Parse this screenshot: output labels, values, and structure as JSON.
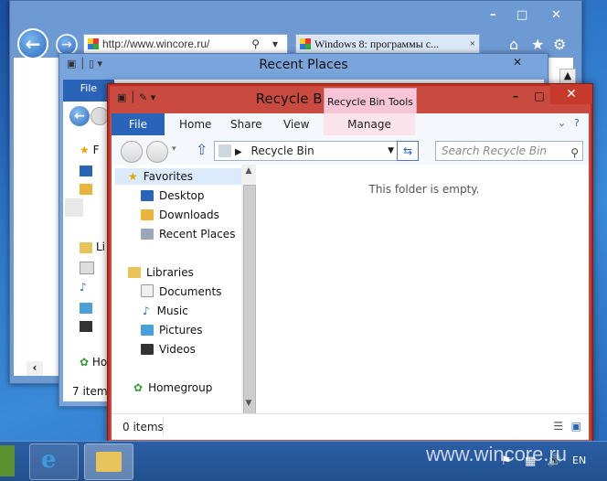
{
  "ie": {
    "url": "http://www.wincore.ru/",
    "tab_title": "Windows 8: программы с...",
    "tab_close": "×",
    "minimize": "–",
    "maximize": "□",
    "close": "✕",
    "back_glyph": "←",
    "forward_glyph": "→"
  },
  "recent_places": {
    "title": "Recent Places",
    "file_menu": "File",
    "status": "7 items",
    "side_items": [
      "F",
      "",
      "",
      "",
      "Li",
      "",
      "",
      "",
      "",
      "Ho"
    ],
    "close": "✕"
  },
  "recycle_bin": {
    "title": "Recycle Bin",
    "tools_tab": "Recycle Bin Tools",
    "menu": {
      "file": "File",
      "home": "Home",
      "share": "Share",
      "view": "View",
      "manage": "Manage"
    },
    "address": "Recycle Bin",
    "search_placeholder": "Search Recycle Bin",
    "empty_message": "This folder is empty.",
    "status": "0 items",
    "nav": {
      "favorites": "Favorites",
      "desktop": "Desktop",
      "downloads": "Downloads",
      "recent_places": "Recent Places",
      "libraries": "Libraries",
      "documents": "Documents",
      "music": "Music",
      "pictures": "Pictures",
      "videos": "Videos",
      "homegroup": "Homegroup"
    },
    "minimize": "–",
    "maximize": "□",
    "close": "✕"
  },
  "taskbar": {
    "language": "EN"
  },
  "watermark": "www.wincore.ru",
  "colors": {
    "accent": "#2a64b8",
    "close_red": "#c7392a",
    "tools_pink": "#f7c6d6"
  }
}
